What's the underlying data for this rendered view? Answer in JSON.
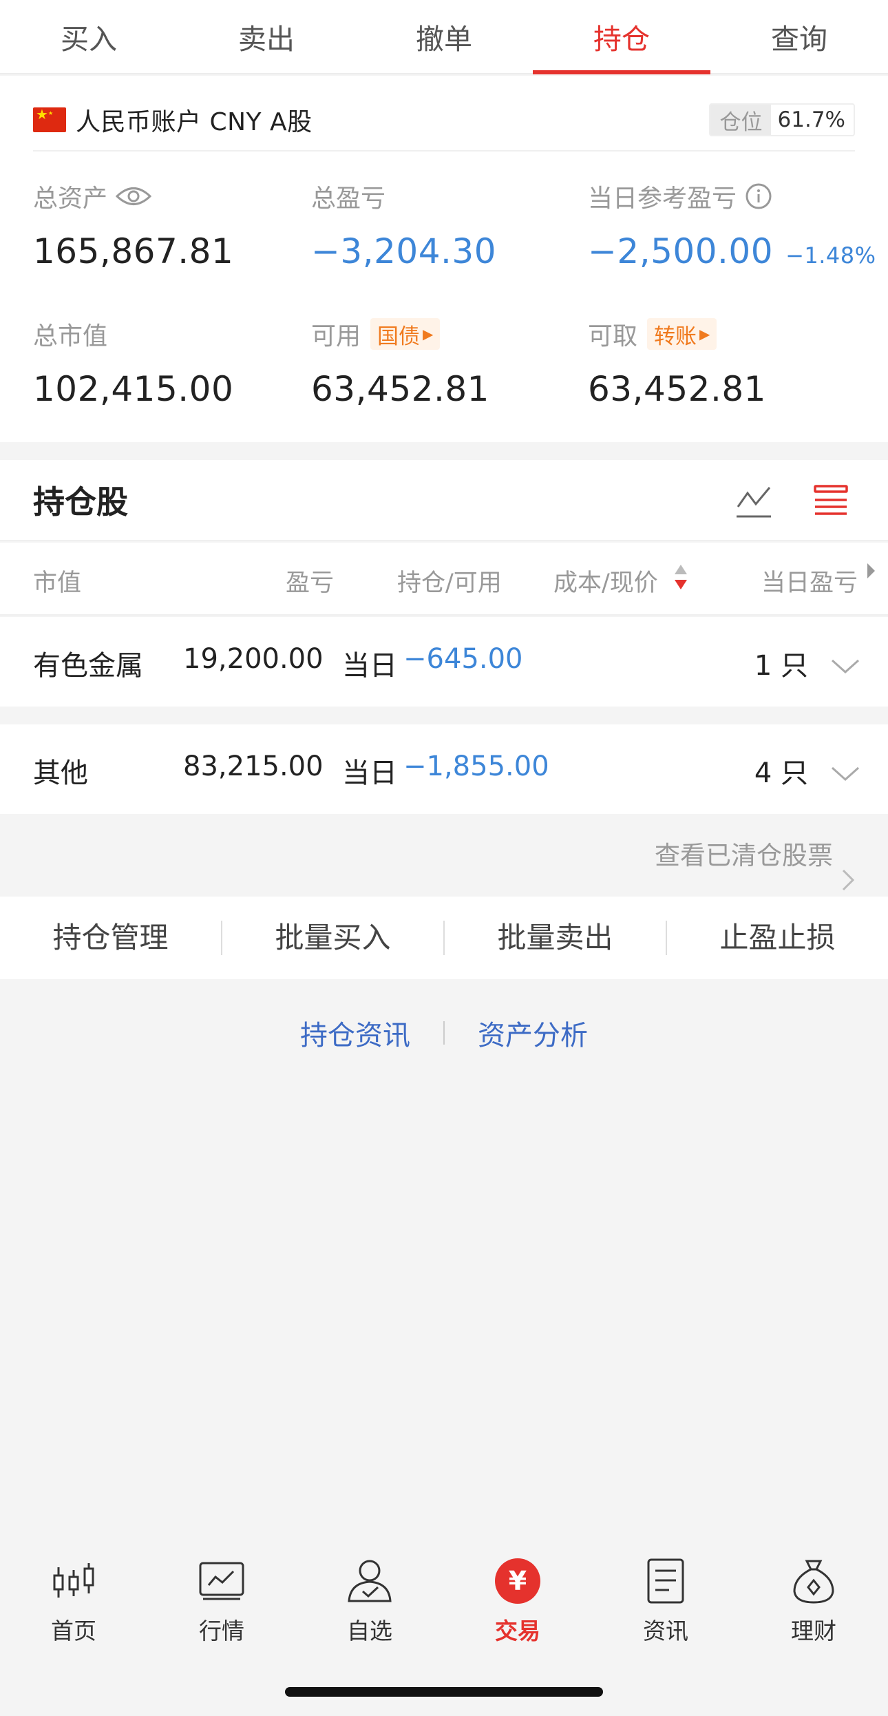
{
  "tabs": [
    "买入",
    "卖出",
    "撤单",
    "持仓",
    "查询"
  ],
  "account": {
    "name": "人民币账户 CNY A股",
    "position_label": "仓位",
    "position_value": "61.7%"
  },
  "stats": {
    "total_assets": {
      "label": "总资产",
      "value": "165,867.81"
    },
    "total_pnl": {
      "label": "总盈亏",
      "value": "−3,204.30"
    },
    "day_pnl": {
      "label": "当日参考盈亏",
      "value": "−2,500.00",
      "pct": "−1.48%"
    },
    "market_value": {
      "label": "总市值",
      "value": "102,415.00"
    },
    "available": {
      "label": "可用",
      "tag": "国债",
      "value": "63,452.81"
    },
    "withdrawable": {
      "label": "可取",
      "tag": "转账",
      "value": "63,452.81"
    }
  },
  "holdings": {
    "title": "持仓股",
    "columns": [
      "市值",
      "盈亏",
      "持仓/可用",
      "成本/现价",
      "当日盈亏"
    ],
    "groups": [
      {
        "name": "有色金属",
        "market_value": "19,200.00",
        "day_label": "当日",
        "day_pnl": "−645.00",
        "count": "1 只"
      },
      {
        "name": "其他",
        "market_value": "83,215.00",
        "day_label": "当日",
        "day_pnl": "−1,855.00",
        "count": "4 只"
      }
    ],
    "cleared_link": "查看已清仓股票"
  },
  "actions": [
    "持仓管理",
    "批量买入",
    "批量卖出",
    "止盈止损"
  ],
  "links": [
    "持仓资讯",
    "资产分析"
  ],
  "bottom_nav": [
    {
      "label": "首页",
      "icon": "candlestick-icon"
    },
    {
      "label": "行情",
      "icon": "chart-icon"
    },
    {
      "label": "自选",
      "icon": "user-check-icon"
    },
    {
      "label": "交易",
      "icon": "yuan-icon",
      "symbol": "¥"
    },
    {
      "label": "资讯",
      "icon": "document-icon"
    },
    {
      "label": "理财",
      "icon": "money-bag-icon"
    }
  ],
  "colors": {
    "accent": "#e5322d",
    "negative": "#3d86d8",
    "link": "#3d6bc5",
    "tag": "#f07a1e"
  }
}
